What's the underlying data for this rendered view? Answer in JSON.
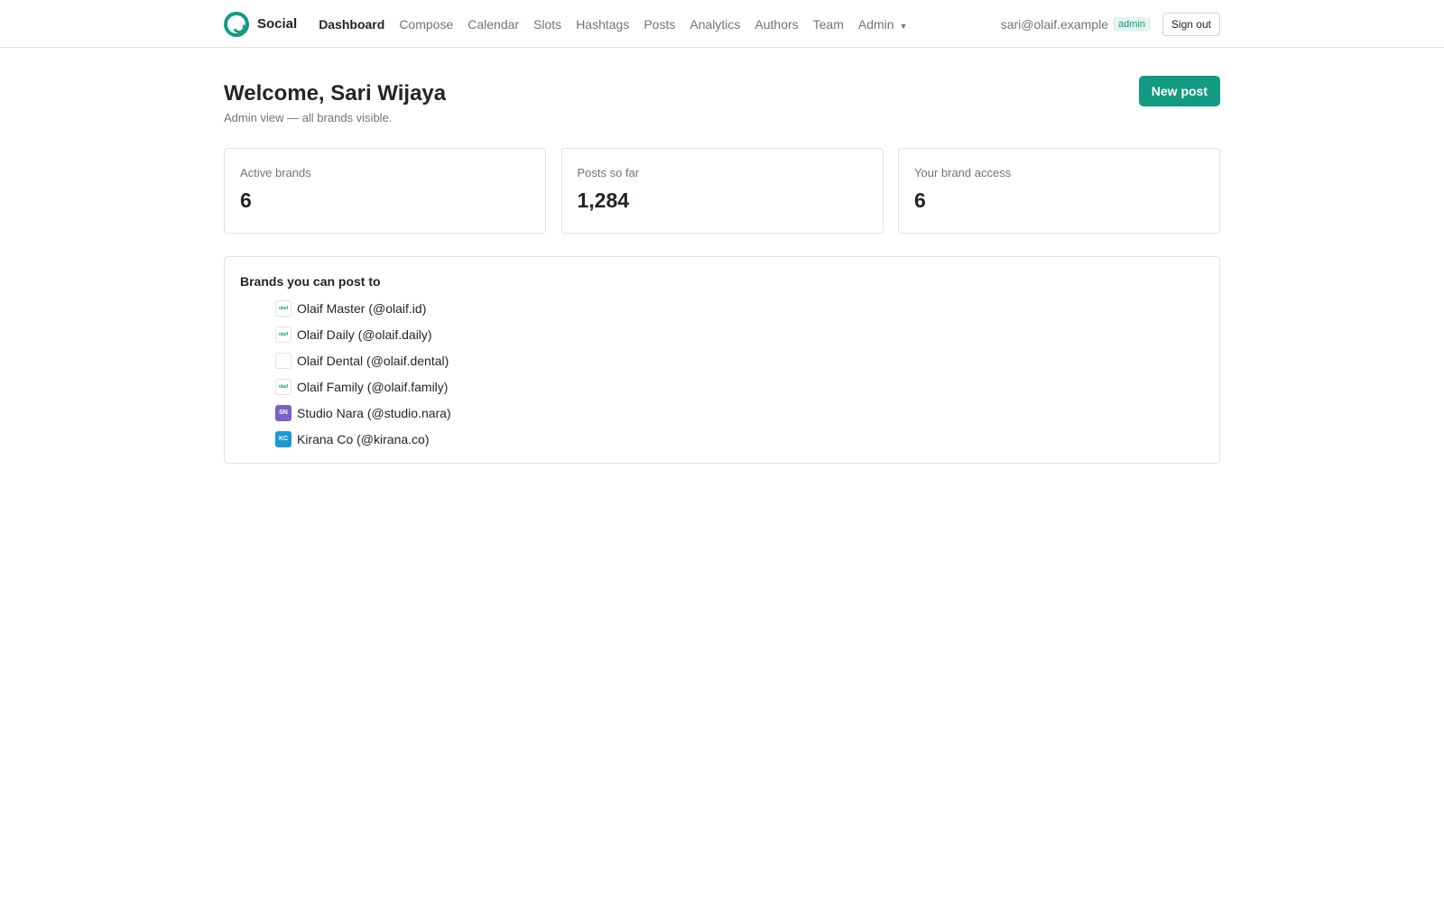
{
  "nav": {
    "brand": "Social",
    "links": [
      "Dashboard",
      "Compose",
      "Calendar",
      "Slots",
      "Hashtags",
      "Posts",
      "Analytics",
      "Authors",
      "Team"
    ],
    "admin_label": "Admin",
    "user_email": "sari@olaif.example",
    "role": "admin",
    "signout": "Sign out"
  },
  "header": {
    "title": "Welcome, Sari Wijaya",
    "subtitle": "Admin view — all brands visible.",
    "new_post": "New post"
  },
  "stats": [
    {
      "label": "Active brands",
      "value": "6"
    },
    {
      "label": "Posts so far",
      "value": "1,284"
    },
    {
      "label": "Your brand access",
      "value": "6"
    }
  ],
  "brands": {
    "title": "Brands you can post to",
    "items": [
      {
        "name": "Olaif Master (@olaif.id)",
        "icon_text": "olaif",
        "icon_color": "#129b82"
      },
      {
        "name": "Olaif Daily (@olaif.daily)",
        "icon_text": "olaif",
        "icon_color": "#129b82"
      },
      {
        "name": "Olaif Dental (@olaif.dental)",
        "icon_text": "",
        "icon_color": "#adb5bd"
      },
      {
        "name": "Olaif Family (@olaif.family)",
        "icon_text": "olaif",
        "icon_color": "#129b82"
      },
      {
        "name": "Studio Nara (@studio.nara)",
        "icon_text": "SN",
        "icon_color": "#7b61c4"
      },
      {
        "name": "Kirana Co (@kirana.co)",
        "icon_text": "KC",
        "icon_color": "#1a9bd7"
      }
    ]
  }
}
